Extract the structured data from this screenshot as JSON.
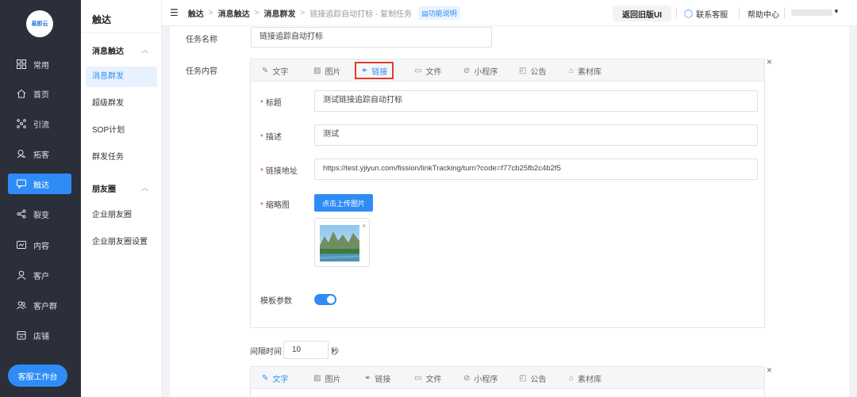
{
  "logo": {
    "text": "易即云"
  },
  "nav": {
    "items": [
      {
        "label": "常用",
        "icon": "grid-icon"
      },
      {
        "label": "首页",
        "icon": "home-icon"
      },
      {
        "label": "引流",
        "icon": "network-icon"
      },
      {
        "label": "拓客",
        "icon": "user-search-icon"
      },
      {
        "label": "触达",
        "icon": "chat-icon"
      },
      {
        "label": "裂变",
        "icon": "share-icon"
      },
      {
        "label": "内容",
        "icon": "content-icon"
      },
      {
        "label": "客户",
        "icon": "user-icon"
      },
      {
        "label": "客户群",
        "icon": "group-icon"
      },
      {
        "label": "店铺",
        "icon": "store-icon"
      }
    ],
    "workspace_button": "客服工作台"
  },
  "subnav": {
    "title": "触达",
    "group1": "消息触达",
    "group1_items": [
      "消息群发",
      "超级群发",
      "SOP计划",
      "群发任务"
    ],
    "group2": "朋友圈",
    "group2_items": [
      "企业朋友圈",
      "企业朋友圈设置"
    ]
  },
  "topbar": {
    "crumbs": [
      "触达",
      "消息触达",
      "消息群发",
      "链接追踪自动打标 - 复制任务"
    ],
    "func_link": "功能说明",
    "old_version": "返回旧版UI",
    "contact": "联系客服",
    "help": "帮助中心"
  },
  "form": {
    "task_name_label": "任务名称",
    "task_name_value": "链接追踪自动打标",
    "task_content_label": "任务内容",
    "tabs": [
      "文字",
      "图片",
      "链接",
      "文件",
      "小程序",
      "公告",
      "素材库"
    ],
    "title_label": "标题",
    "title_value": "测试链接追踪自动打标",
    "desc_label": "描述",
    "desc_value": "测试",
    "url_label": "链接地址",
    "url_value": "https://test.yjiyun.com/fission/linkTracking/turn?code=f77cb25fb2c4b2f5",
    "thumb_label": "缩略图",
    "upload_button": "点击上传图片",
    "template_label": "模板参数",
    "template_on": true,
    "interval_label": "间隔时间",
    "interval_value": "10",
    "interval_unit": "秒"
  },
  "colors": {
    "accent": "#2f8cf6",
    "highlight": "#e33b2e",
    "nav_bg": "#2b2f3a"
  }
}
